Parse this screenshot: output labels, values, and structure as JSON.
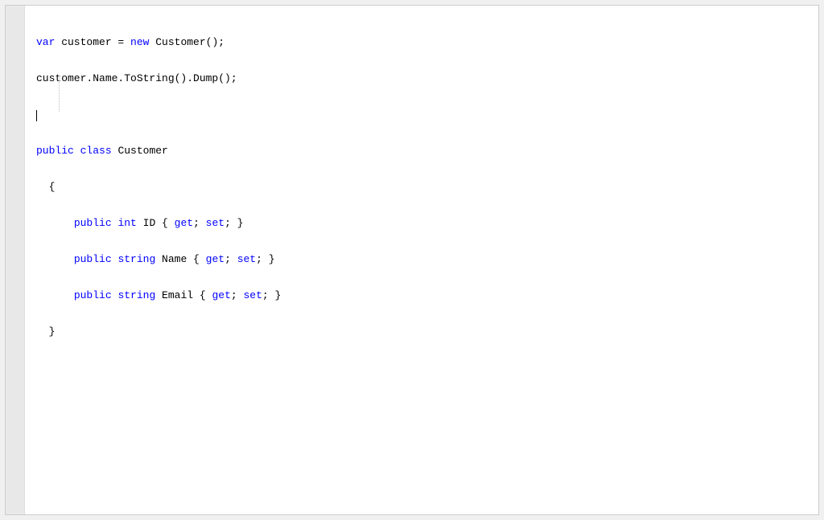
{
  "code": {
    "line1": {
      "t1": "var",
      "t2": " customer = ",
      "t3": "new",
      "t4": " Customer();"
    },
    "line2": "customer.Name.ToString().Dump();",
    "line4": {
      "t1": "public",
      "t2": " ",
      "t3": "class",
      "t4": " Customer"
    },
    "line5": "  {",
    "line6": {
      "t1": "      ",
      "t2": "public",
      "t3": " ",
      "t4": "int",
      "t5": " ID { ",
      "t6": "get",
      "t7": "; ",
      "t8": "set",
      "t9": "; }"
    },
    "line7": {
      "t1": "      ",
      "t2": "public",
      "t3": " ",
      "t4": "string",
      "t5": " Name { ",
      "t6": "get",
      "t7": "; ",
      "t8": "set",
      "t9": "; }"
    },
    "line8": {
      "t1": "      ",
      "t2": "public",
      "t3": " ",
      "t4": "string",
      "t5": " Email { ",
      "t6": "get",
      "t7": "; ",
      "t8": "set",
      "t9": "; }"
    },
    "line9": "  }"
  }
}
